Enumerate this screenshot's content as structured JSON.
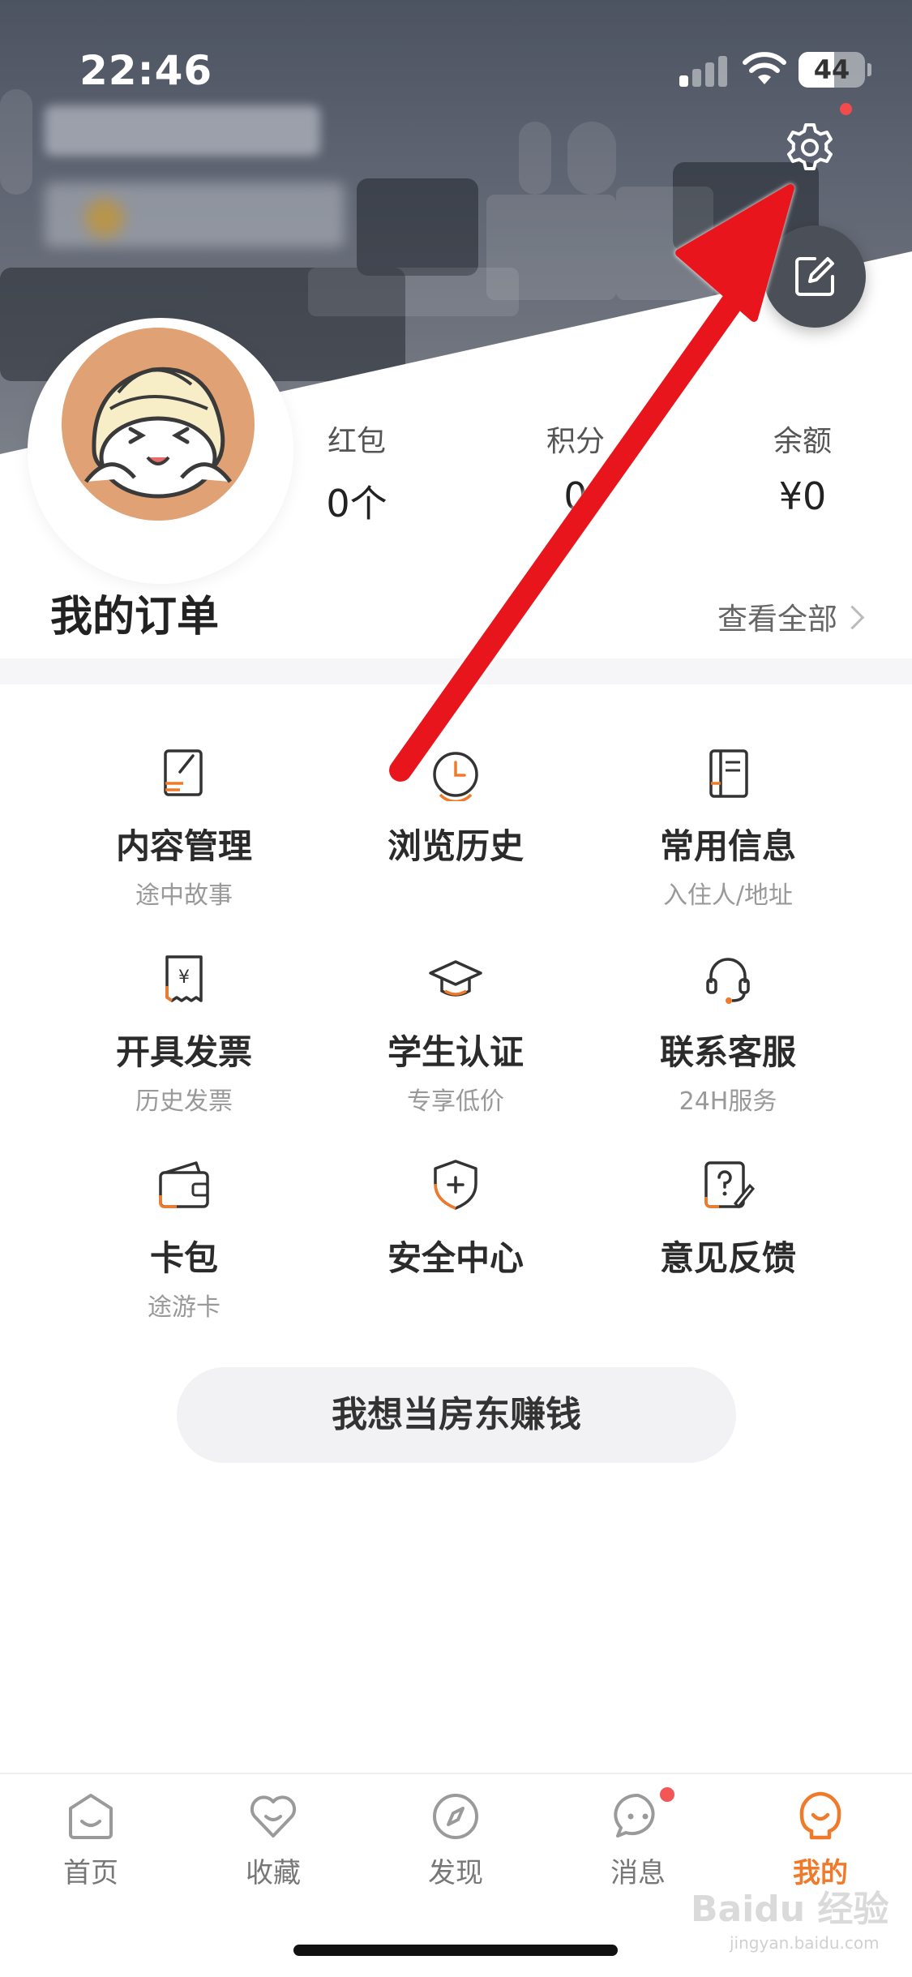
{
  "status_bar": {
    "time": "22:46",
    "battery": "44"
  },
  "header": {
    "settings_icon": "gear-icon",
    "edit_icon": "edit-icon"
  },
  "stats": [
    {
      "label": "红包",
      "value": "0个"
    },
    {
      "label": "积分",
      "value": "0"
    },
    {
      "label": "余额",
      "value": "¥0"
    }
  ],
  "orders": {
    "title": "我的订单",
    "view_all": "查看全部"
  },
  "grid": [
    {
      "title": "内容管理",
      "subtitle": "途中故事",
      "icon": "edit-document-icon"
    },
    {
      "title": "浏览历史",
      "subtitle": "",
      "icon": "clock-icon"
    },
    {
      "title": "常用信息",
      "subtitle": "入住人/地址",
      "icon": "notebook-icon"
    },
    {
      "title": "开具发票",
      "subtitle": "历史发票",
      "icon": "invoice-icon"
    },
    {
      "title": "学生认证",
      "subtitle": "专享低价",
      "icon": "graduation-cap-icon"
    },
    {
      "title": "联系客服",
      "subtitle": "24H服务",
      "icon": "headset-icon"
    },
    {
      "title": "卡包",
      "subtitle": "途游卡",
      "icon": "wallet-icon"
    },
    {
      "title": "安全中心",
      "subtitle": "",
      "icon": "shield-icon"
    },
    {
      "title": "意见反馈",
      "subtitle": "",
      "icon": "feedback-icon"
    }
  ],
  "landlord_button": "我想当房东赚钱",
  "tabbar": [
    {
      "label": "首页",
      "icon": "home-icon"
    },
    {
      "label": "收藏",
      "icon": "heart-icon"
    },
    {
      "label": "发现",
      "icon": "compass-icon"
    },
    {
      "label": "消息",
      "icon": "message-icon"
    },
    {
      "label": "我的",
      "icon": "profile-icon"
    }
  ],
  "watermark": {
    "brand": "Baidu 经验",
    "url": "jingyan.baidu.com"
  },
  "colors": {
    "accent": "#f07a2a",
    "badge": "#f24b4b",
    "annotation_arrow": "#e8191c"
  }
}
